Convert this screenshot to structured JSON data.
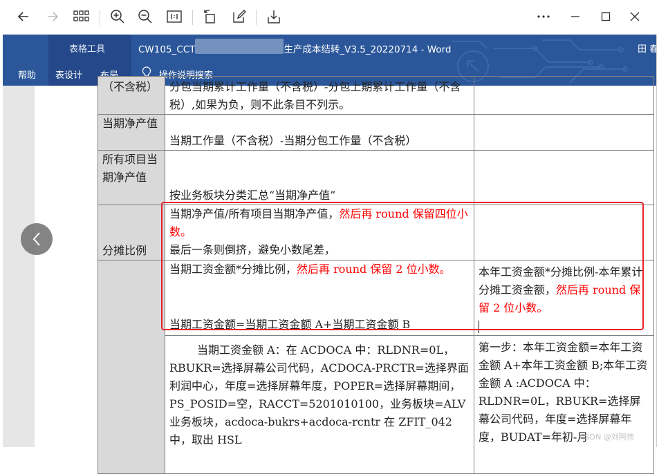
{
  "ribbon": {
    "context_label": "表格工具",
    "title_prefix": "CW105_CCT",
    "title_suffix": "生产成本结转_V3.5_20220714  -  Word",
    "user": "田 春",
    "tabs": [
      "帮助",
      "表设计",
      "布局",
      "操作说明搜索"
    ]
  },
  "table": {
    "r1": {
      "c1": "（不含税）",
      "c2": "分包当期累计工作量（不含税）-分包上期累计工作量（不含税）,如果为负，则不此条目不列示。",
      "c3": ""
    },
    "r2": {
      "c1": "当期净产值",
      "c2": "当期工作量（不含税）-当期分包工作量（不含税）",
      "c3": ""
    },
    "r3": {
      "c1": "所有项目当期净产值",
      "c2": "按业务板块分类汇总“当期净产值”",
      "c3": ""
    },
    "r4": {
      "c1": "分摊比例",
      "c2_black": "当期净产值/所有项目当期净产值，",
      "c2_red": "然后再 round 保留四位小数。",
      "c2_line2": "最后一条则倒挤，避免小数尾差，",
      "c3": ""
    },
    "r5": {
      "c2_black": "当期工资金额*分摊比例，",
      "c2_red": "然后再 round 保留 2 位小数。",
      "c2_bottom": "当期工资金额=当期工资金额 A+当期工资金额 B",
      "c3_black": "本年工资金额*分摊比例-本年累计分摊工资金额，",
      "c3_red": "然后再 round 保留 2 位小数。"
    },
    "r6": {
      "c2": "当期工资金额 A：在 ACDOCA 中：RLDNR=0L，RBUKR=选择屏幕公司代码，ACDOCA-PRCTR=选择界面利润中心，年度=选择屏幕年度，POPER=选择屏幕期间，PS_POSID=空，RACCT=5201010100，业务板块=ALV 业务板块，acdoca-bukrs+acdoca-rcntr 在 ZFIT_042 中，取出 HSL",
      "c3": "第一步：本年工资金额=本年工资金额 A+本年工资金额 B;本年工资金额 A :ACDOCA 中：RLDNR=0L，RBUKR=选择屏幕公司代码，年度=选择屏幕年度，BUDAT=年初-月"
    }
  },
  "watermark": "CSDN @刘阿伟",
  "colors": {
    "ribbon": "#2b579a",
    "highlight": "#e8232a",
    "red_text": "#ff0000"
  },
  "icons": [
    "back-arrow-icon",
    "forward-arrow-icon",
    "grid-view-icon",
    "zoom-in-icon",
    "zoom-out-icon",
    "actual-size-icon",
    "rotate-icon",
    "edit-icon",
    "save-icon",
    "more-icon",
    "minimize-icon",
    "maximize-icon",
    "close-icon",
    "lightbulb-icon",
    "chevron-left-icon"
  ]
}
